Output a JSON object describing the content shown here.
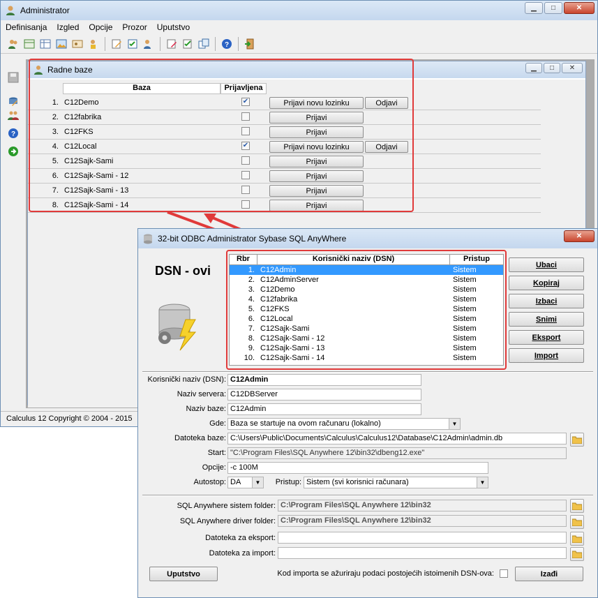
{
  "main_window": {
    "title": "Administrator",
    "menu": [
      "Definisanja",
      "Izgled",
      "Opcije",
      "Prozor",
      "Uputstvo"
    ],
    "status": "Calculus 12  Copyright © 2004 - 2015"
  },
  "radne_baze": {
    "title": "Radne baze",
    "col_baza": "Baza",
    "col_prijavljena": "Prijavljena",
    "rows": [
      {
        "num": "1.",
        "name": "C12Demo",
        "checked": true,
        "btn": "Prijavi novu lozinku",
        "odjavi": "Odjavi"
      },
      {
        "num": "2.",
        "name": "C12fabrika",
        "checked": false,
        "btn": "Prijavi",
        "odjavi": ""
      },
      {
        "num": "3.",
        "name": "C12FKS",
        "checked": false,
        "btn": "Prijavi",
        "odjavi": ""
      },
      {
        "num": "4.",
        "name": "C12Local",
        "checked": true,
        "btn": "Prijavi novu lozinku",
        "odjavi": "Odjavi"
      },
      {
        "num": "5.",
        "name": "C12Sajk-Sami",
        "checked": false,
        "btn": "Prijavi",
        "odjavi": ""
      },
      {
        "num": "6.",
        "name": "C12Sajk-Sami - 12",
        "checked": false,
        "btn": "Prijavi",
        "odjavi": ""
      },
      {
        "num": "7.",
        "name": "C12Sajk-Sami - 13",
        "checked": false,
        "btn": "Prijavi",
        "odjavi": ""
      },
      {
        "num": "8.",
        "name": "C12Sajk-Sami - 14",
        "checked": false,
        "btn": "Prijavi",
        "odjavi": ""
      }
    ]
  },
  "dsn_window": {
    "title": "32-bit ODBC Administrator Sybase SQL AnyWhere",
    "heading": "DSN - ovi",
    "col_rbr": "Rbr",
    "col_name": "Korisnički naziv (DSN)",
    "col_pristup": "Pristup",
    "rows": [
      {
        "num": "1.",
        "name": "C12Admin",
        "access": "Sistem",
        "selected": true
      },
      {
        "num": "2.",
        "name": "C12AdminServer",
        "access": "Sistem",
        "selected": false
      },
      {
        "num": "3.",
        "name": "C12Demo",
        "access": "Sistem",
        "selected": false
      },
      {
        "num": "4.",
        "name": "C12fabrika",
        "access": "Sistem",
        "selected": false
      },
      {
        "num": "5.",
        "name": "C12FKS",
        "access": "Sistem",
        "selected": false
      },
      {
        "num": "6.",
        "name": "C12Local",
        "access": "Sistem",
        "selected": false
      },
      {
        "num": "7.",
        "name": "C12Sajk-Sami",
        "access": "Sistem",
        "selected": false
      },
      {
        "num": "8.",
        "name": "C12Sajk-Sami - 12",
        "access": "Sistem",
        "selected": false
      },
      {
        "num": "9.",
        "name": "C12Sajk-Sami - 13",
        "access": "Sistem",
        "selected": false
      },
      {
        "num": "10.",
        "name": "C12Sajk-Sami - 14",
        "access": "Sistem",
        "selected": false
      }
    ],
    "buttons": {
      "ubaci": "Ubaci",
      "kopiraj": "Kopiraj",
      "izbaci": "Izbaci",
      "snimi": "Snimi",
      "eksport": "Eksport",
      "import": "Import"
    },
    "form": {
      "dsn_label": "Korisnički naziv (DSN):",
      "dsn_value": "C12Admin",
      "server_label": "Naziv servera:",
      "server_value": "C12DBServer",
      "baza_label": "Naziv baze:",
      "baza_value": "C12Admin",
      "gde_label": "Gde:",
      "gde_value": "Baza se startuje na ovom računaru (lokalno)",
      "datoteka_label": "Datoteka baze:",
      "datoteka_value": "C:\\Users\\Public\\Documents\\Calculus\\Calculus12\\Database\\C12Admin\\admin.db",
      "start_label": "Start:",
      "start_value": "\"C:\\Program Files\\SQL Anywhere 12\\bin32\\dbeng12.exe\"",
      "opcije_label": "Opcije:",
      "opcije_value": "-c 100M",
      "autostop_label": "Autostop:",
      "autostop_value": "DA",
      "pristup_label": "Pristup:",
      "pristup_value": "Sistem (svi korisnici računara)"
    },
    "paths": {
      "sistem_label": "SQL Anywhere sistem folder:",
      "sistem_value": "C:\\Program Files\\SQL Anywhere 12\\bin32",
      "driver_label": "SQL Anywhere driver folder:",
      "driver_value": "C:\\Program Files\\SQL Anywhere 12\\bin32",
      "eksport_label": "Datoteka za eksport:",
      "eksport_value": "",
      "import_label": "Datoteka za import:",
      "import_value": ""
    },
    "uputstvo": "Uputstvo",
    "note": "Kod importa se ažuriraju podaci postojećih istoimenih DSN-ova:",
    "izadji": "Izađi"
  }
}
